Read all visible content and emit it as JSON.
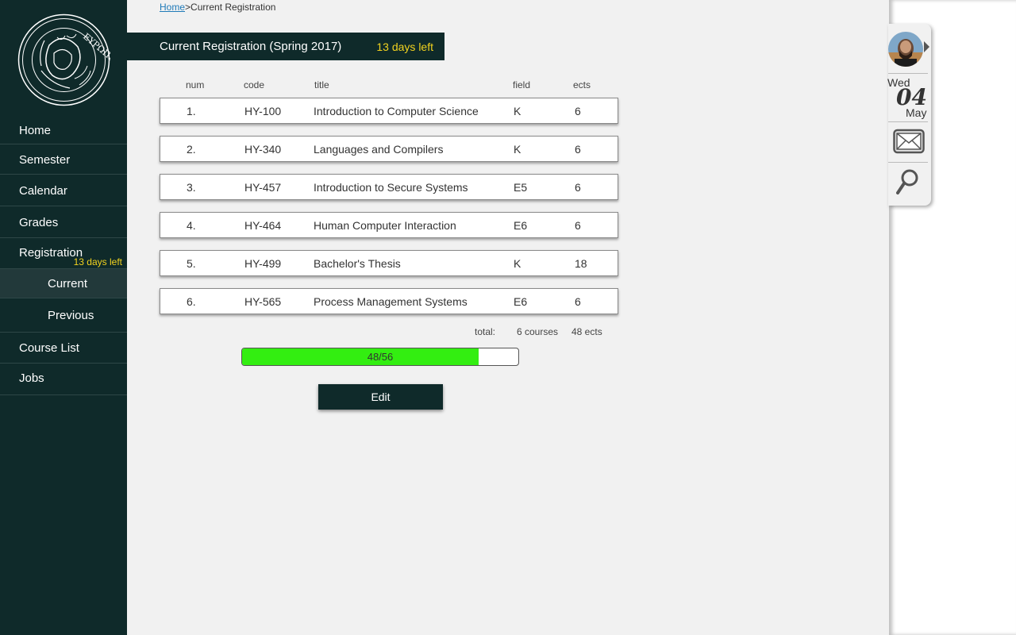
{
  "sidebar": {
    "logo_icon": "university-seal-logo",
    "items": {
      "home": "Home",
      "semester": "Semester",
      "calendar": "Calendar",
      "grades": "Grades",
      "registration": "Registration",
      "registration_badge": "13 days left",
      "current": "Current",
      "previous": "Previous",
      "course_list": "Course List",
      "jobs": "Jobs"
    }
  },
  "breadcrumb": {
    "home": "Home",
    "separator": ">",
    "current": "Current Registration"
  },
  "header": {
    "title": "Current Registration (Spring 2017)",
    "days_left": "13 days left"
  },
  "table": {
    "columns": {
      "num": "num",
      "code": "code",
      "title": "title",
      "field": "field",
      "ects": "ects"
    },
    "rows": [
      {
        "num": "1.",
        "code": "HY-100",
        "title": "Introduction to Computer Science",
        "field": "K",
        "ects": "6"
      },
      {
        "num": "2.",
        "code": "HY-340",
        "title": "Languages and Compilers",
        "field": "K",
        "ects": "6"
      },
      {
        "num": "3.",
        "code": "HY-457",
        "title": "Introduction to Secure Systems",
        "field": "E5",
        "ects": "6"
      },
      {
        "num": "4.",
        "code": "HY-464",
        "title": "Human Computer Interaction",
        "field": "E6",
        "ects": "6"
      },
      {
        "num": "5.",
        "code": "HY-499",
        "title": "Bachelor's Thesis",
        "field": "K",
        "ects": "18"
      },
      {
        "num": "6.",
        "code": "HY-565",
        "title": "Process Management Systems",
        "field": "E6",
        "ects": "6"
      }
    ]
  },
  "totals": {
    "label": "total:",
    "courses": "6 courses",
    "ects": "48 ects"
  },
  "progress": {
    "text": "48/56",
    "value": 48,
    "max": 56
  },
  "edit_button": "Edit",
  "widget": {
    "day_of_week": "Wed",
    "day": "04",
    "month": "May",
    "icons": [
      "user-avatar",
      "mail-icon",
      "search-icon"
    ]
  },
  "colors": {
    "sidebar": "#0f2a2a",
    "accent_yellow": "#f2d21f",
    "progress_fill": "#33ee11",
    "link": "#1f7ab8"
  }
}
